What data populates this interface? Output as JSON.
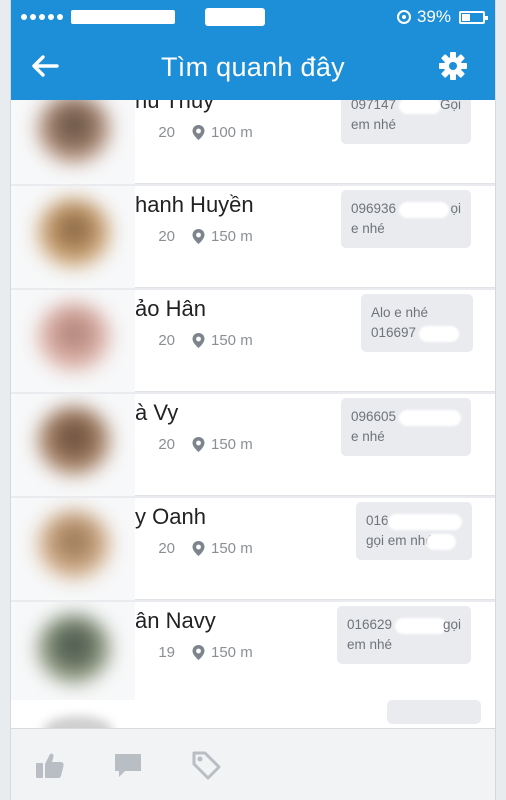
{
  "status_bar": {
    "battery_percent": "39%",
    "battery_level": 0.39
  },
  "header": {
    "title": "Tìm quanh đây",
    "back_icon": "back-arrow-icon",
    "settings_icon": "gear-icon"
  },
  "users": [
    {
      "name": "hu Thúy",
      "age": "20",
      "distance": "100 m",
      "message_lines": [
        "097147",
        "em nhé"
      ],
      "message_tail": "Gọi"
    },
    {
      "name": "hanh Huyền",
      "age": "20",
      "distance": "150 m",
      "message_lines": [
        "096936",
        "e nhé"
      ],
      "message_tail": "ọi"
    },
    {
      "name": "ảo Hân",
      "age": "20",
      "distance": "150 m",
      "message_lines": [
        "Alo e nhé",
        "016697"
      ],
      "message_tail": ""
    },
    {
      "name": "à Vy",
      "age": "20",
      "distance": "150 m",
      "message_lines": [
        "096605",
        "e nhé"
      ],
      "message_tail": ""
    },
    {
      "name": "y Oanh",
      "age": "20",
      "distance": "150 m",
      "message_lines": [
        "016",
        "gọi em nhé"
      ],
      "message_tail": ""
    },
    {
      "name": "ân Navy",
      "age": "19",
      "distance": "150 m",
      "message_lines": [
        "016629",
        "em nhé"
      ],
      "message_tail": "gọi"
    }
  ],
  "tab_bar": {
    "items": [
      {
        "icon": "thumbs-up-icon"
      },
      {
        "icon": "chat-bubble-icon"
      },
      {
        "icon": "tag-icon"
      }
    ]
  },
  "colors": {
    "primary": "#1d8fd8",
    "bubble": "#e9ebee",
    "icon_gray": "#b9bec4"
  }
}
